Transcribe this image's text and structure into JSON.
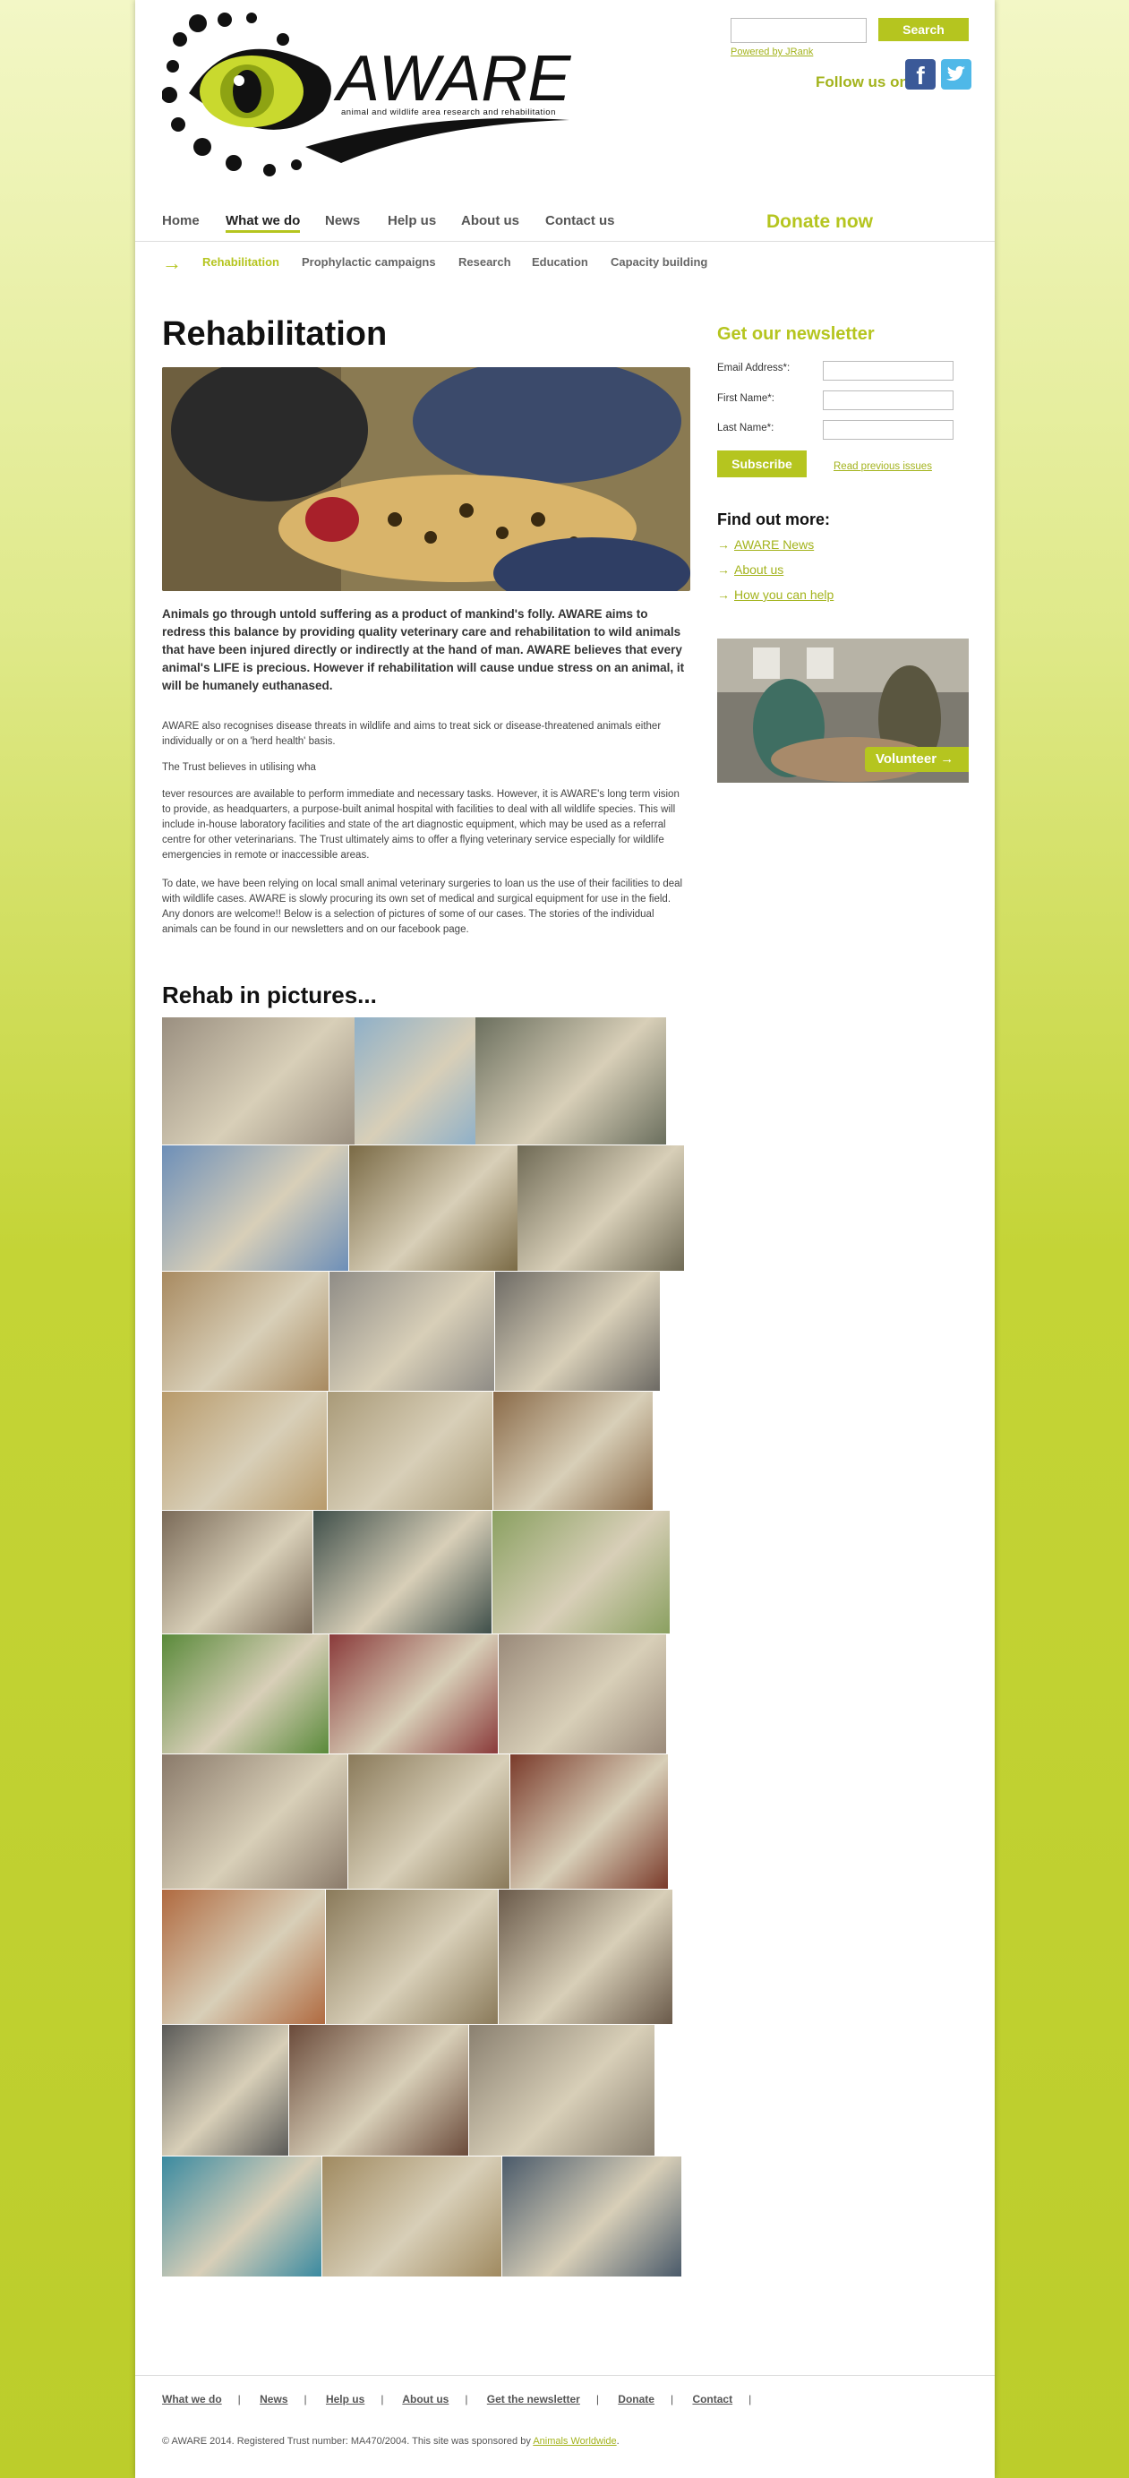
{
  "header": {
    "logo_title": "AWARE",
    "logo_subtitle": "animal and wildlife area research and rehabilitation",
    "search_button": "Search",
    "powered_by": "Powered by JRank",
    "follow_us": "Follow us on",
    "facebook_icon_letter": "f",
    "twitter_icon_letter": "t"
  },
  "nav": {
    "items": [
      {
        "label": "Home"
      },
      {
        "label": "What we do"
      },
      {
        "label": "News"
      },
      {
        "label": "Help us"
      },
      {
        "label": "About us"
      },
      {
        "label": "Contact us"
      }
    ],
    "donate": "Donate now"
  },
  "subnav": {
    "arrow": "→",
    "items": [
      {
        "label": "Rehabilitation"
      },
      {
        "label": "Prophylactic campaigns"
      },
      {
        "label": "Research"
      },
      {
        "label": "Education"
      },
      {
        "label": "Capacity building"
      }
    ]
  },
  "main": {
    "title": "Rehabilitation",
    "lead": "Animals go through untold suffering as a product of mankind's folly. AWARE aims to redress this balance by providing quality veterinary care and rehabilitation to wild animals that have been injured directly or indirectly at the hand of man. AWARE believes that every animal's LIFE is precious. However if rehabilitation will cause undue stress on an animal, it will be humanely euthanased.",
    "para1": "AWARE also recognises disease threats in wildlife and aims to treat sick or disease-threatened animals either individually or on a 'herd health' basis.",
    "para2": "The Trust believes in utilising wha",
    "para3": "tever resources are available to perform immediate and necessary tasks. However, it is AWARE's long term vision to provide, as headquarters, a purpose-built animal hospital with facilities to deal with all wildlife species. This will include in-house laboratory facilities and state of the art diagnostic equipment, which may be used as a referral centre for other veterinarians. The Trust ultimately aims to offer a flying veterinary service especially for wildlife emergencies in remote or inaccessible areas.",
    "para4": "To date, we have been relying on local small animal veterinary surgeries to loan us the use of their facilities to deal with wildlife cases. AWARE is slowly procuring its own set of medical and surgical equipment for use in the field. Any donors are welcome!! Below is a selection of pictures of some of our cases. The stories of the individual animals can be found in our newsletters and on our facebook page.",
    "gallery_title": "Rehab in pictures..."
  },
  "sidebar": {
    "newsletter_title": "Get our newsletter",
    "email_label": "Email Address*:",
    "first_name_label": "First Name*:",
    "last_name_label": "Last Name*:",
    "subscribe": "Subscribe",
    "read_previous": "Read previous issues",
    "find_more_title": "Find out more:",
    "links": [
      {
        "label": "AWARE News"
      },
      {
        "label": "About us"
      },
      {
        "label": "How you can help"
      }
    ],
    "volunteer": "Volunteer"
  },
  "footer": {
    "links": [
      {
        "label": "What we do"
      },
      {
        "label": "News"
      },
      {
        "label": "Help us"
      },
      {
        "label": "About us"
      },
      {
        "label": "Get the newsletter"
      },
      {
        "label": "Donate"
      },
      {
        "label": "Contact"
      }
    ],
    "copyright": "© AWARE 2014. Registered Trust number: MA470/2004. This site was sponsored by",
    "sponsor": "Animals Worldwide",
    "copyright_end": "."
  }
}
